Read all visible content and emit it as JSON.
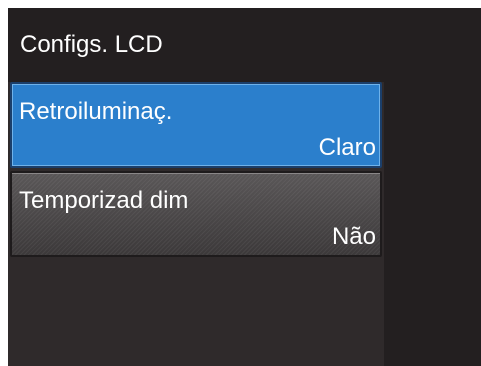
{
  "header": {
    "title": "Configs. LCD"
  },
  "menu": {
    "items": [
      {
        "label": "Retroiluminaç.",
        "value": "Claro",
        "selected": true
      },
      {
        "label": "Temporizad dim",
        "value": "Não",
        "selected": false
      }
    ]
  },
  "colors": {
    "background": "#231f20",
    "selected_item": "#2b7fcc",
    "normal_item": "#4a4748",
    "text": "#ffffff"
  }
}
